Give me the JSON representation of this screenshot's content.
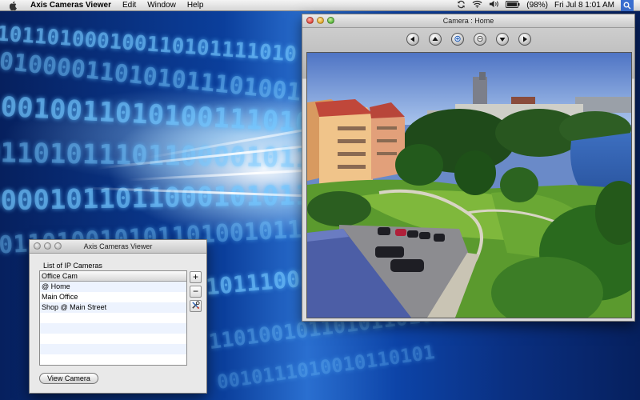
{
  "menubar": {
    "app_name": "Axis Cameras Viewer",
    "menus": [
      "Edit",
      "Window",
      "Help"
    ],
    "battery": "(98%)",
    "datetime": "Fri Jul 8  1:01 AM"
  },
  "icons": {
    "apple": "apple-icon",
    "sync": "sync-icon",
    "wifi": "wifi-icon",
    "volume": "volume-icon",
    "battery": "battery-icon",
    "spotlight": "spotlight-icon",
    "pan_left": "arrow-left-icon",
    "tilt_up": "arrow-up-icon",
    "zoom_in": "zoom-in-icon",
    "zoom_out": "zoom-out-icon",
    "tilt_down": "arrow-down-icon",
    "pan_right": "arrow-right-icon",
    "settings": "wrench-screwdriver-icon"
  },
  "camera_window": {
    "title": "Camera : Home"
  },
  "list_window": {
    "title": "Axis Cameras Viewer",
    "heading": "List of IP Cameras",
    "cameras": [
      "Office Cam",
      "@ Home",
      "Main Office",
      "Shop @ Main Street"
    ],
    "add_label": "+",
    "remove_label": "−",
    "view_button_label": "View Camera"
  },
  "colors": {
    "menubar": "#e6e6e6",
    "row_alt": "#edf3fe",
    "close": "#e0443a",
    "minimize": "#e0a628",
    "zoom": "#54b43a"
  }
}
